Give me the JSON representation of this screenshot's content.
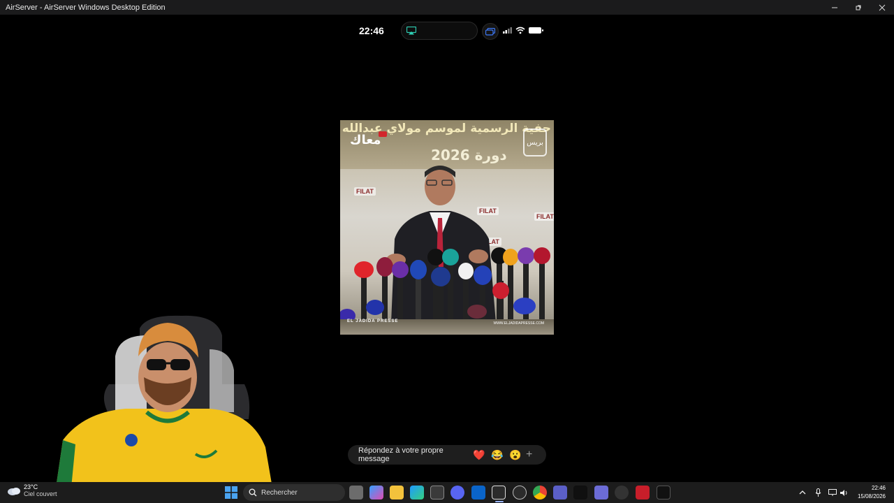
{
  "window": {
    "title": "AirServer - AirServer Windows Desktop Edition",
    "controls": [
      "minimize-icon",
      "maximize-icon",
      "close-icon"
    ]
  },
  "phone_status": {
    "time": "22:46",
    "icons": [
      "airplay-icon",
      "screen-mirror-icon",
      "signal-icon",
      "wifi-icon",
      "battery-icon"
    ]
  },
  "video": {
    "banner_line1": "حفية الرسمية لموسم مولاي عبدالله أمغار",
    "banner_line2": "دورة 2026",
    "logo_left": "معاك",
    "logo_right": "بريس",
    "backdrop_brand": "FILAT",
    "footer_left": "EL JADIDA PRESSE",
    "footer_right": "WWW.ELJADIDAPRESSE.COM"
  },
  "reply_bar": {
    "placeholder": "Répondez à votre propre message",
    "reactions": [
      "❤️",
      "😂",
      "😮"
    ],
    "add_label": "+"
  },
  "taskbar": {
    "weather_temp": "23°C",
    "weather_desc": "Ciel couvert",
    "search_placeholder": "Rechercher",
    "clock_time": "22:46",
    "clock_date": "15/08/2026"
  },
  "colors": {
    "titlebar": "#1b1b1c",
    "taskbar": "#1c1c1c",
    "reply_bar": "#1e1e1e",
    "accent": "#9ab4ff"
  }
}
